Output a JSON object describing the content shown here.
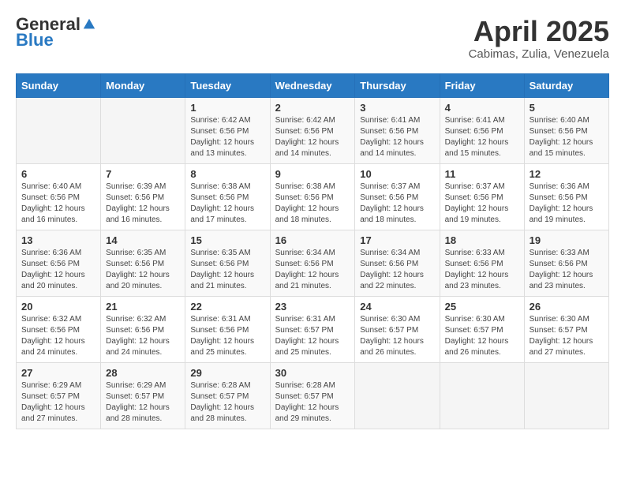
{
  "logo": {
    "general": "General",
    "blue": "Blue"
  },
  "header": {
    "month_title": "April 2025",
    "subtitle": "Cabimas, Zulia, Venezuela"
  },
  "weekdays": [
    "Sunday",
    "Monday",
    "Tuesday",
    "Wednesday",
    "Thursday",
    "Friday",
    "Saturday"
  ],
  "weeks": [
    [
      {
        "day": "",
        "sunrise": "",
        "sunset": "",
        "daylight": ""
      },
      {
        "day": "",
        "sunrise": "",
        "sunset": "",
        "daylight": ""
      },
      {
        "day": "1",
        "sunrise": "Sunrise: 6:42 AM",
        "sunset": "Sunset: 6:56 PM",
        "daylight": "Daylight: 12 hours and 13 minutes."
      },
      {
        "day": "2",
        "sunrise": "Sunrise: 6:42 AM",
        "sunset": "Sunset: 6:56 PM",
        "daylight": "Daylight: 12 hours and 14 minutes."
      },
      {
        "day": "3",
        "sunrise": "Sunrise: 6:41 AM",
        "sunset": "Sunset: 6:56 PM",
        "daylight": "Daylight: 12 hours and 14 minutes."
      },
      {
        "day": "4",
        "sunrise": "Sunrise: 6:41 AM",
        "sunset": "Sunset: 6:56 PM",
        "daylight": "Daylight: 12 hours and 15 minutes."
      },
      {
        "day": "5",
        "sunrise": "Sunrise: 6:40 AM",
        "sunset": "Sunset: 6:56 PM",
        "daylight": "Daylight: 12 hours and 15 minutes."
      }
    ],
    [
      {
        "day": "6",
        "sunrise": "Sunrise: 6:40 AM",
        "sunset": "Sunset: 6:56 PM",
        "daylight": "Daylight: 12 hours and 16 minutes."
      },
      {
        "day": "7",
        "sunrise": "Sunrise: 6:39 AM",
        "sunset": "Sunset: 6:56 PM",
        "daylight": "Daylight: 12 hours and 16 minutes."
      },
      {
        "day": "8",
        "sunrise": "Sunrise: 6:38 AM",
        "sunset": "Sunset: 6:56 PM",
        "daylight": "Daylight: 12 hours and 17 minutes."
      },
      {
        "day": "9",
        "sunrise": "Sunrise: 6:38 AM",
        "sunset": "Sunset: 6:56 PM",
        "daylight": "Daylight: 12 hours and 18 minutes."
      },
      {
        "day": "10",
        "sunrise": "Sunrise: 6:37 AM",
        "sunset": "Sunset: 6:56 PM",
        "daylight": "Daylight: 12 hours and 18 minutes."
      },
      {
        "day": "11",
        "sunrise": "Sunrise: 6:37 AM",
        "sunset": "Sunset: 6:56 PM",
        "daylight": "Daylight: 12 hours and 19 minutes."
      },
      {
        "day": "12",
        "sunrise": "Sunrise: 6:36 AM",
        "sunset": "Sunset: 6:56 PM",
        "daylight": "Daylight: 12 hours and 19 minutes."
      }
    ],
    [
      {
        "day": "13",
        "sunrise": "Sunrise: 6:36 AM",
        "sunset": "Sunset: 6:56 PM",
        "daylight": "Daylight: 12 hours and 20 minutes."
      },
      {
        "day": "14",
        "sunrise": "Sunrise: 6:35 AM",
        "sunset": "Sunset: 6:56 PM",
        "daylight": "Daylight: 12 hours and 20 minutes."
      },
      {
        "day": "15",
        "sunrise": "Sunrise: 6:35 AM",
        "sunset": "Sunset: 6:56 PM",
        "daylight": "Daylight: 12 hours and 21 minutes."
      },
      {
        "day": "16",
        "sunrise": "Sunrise: 6:34 AM",
        "sunset": "Sunset: 6:56 PM",
        "daylight": "Daylight: 12 hours and 21 minutes."
      },
      {
        "day": "17",
        "sunrise": "Sunrise: 6:34 AM",
        "sunset": "Sunset: 6:56 PM",
        "daylight": "Daylight: 12 hours and 22 minutes."
      },
      {
        "day": "18",
        "sunrise": "Sunrise: 6:33 AM",
        "sunset": "Sunset: 6:56 PM",
        "daylight": "Daylight: 12 hours and 23 minutes."
      },
      {
        "day": "19",
        "sunrise": "Sunrise: 6:33 AM",
        "sunset": "Sunset: 6:56 PM",
        "daylight": "Daylight: 12 hours and 23 minutes."
      }
    ],
    [
      {
        "day": "20",
        "sunrise": "Sunrise: 6:32 AM",
        "sunset": "Sunset: 6:56 PM",
        "daylight": "Daylight: 12 hours and 24 minutes."
      },
      {
        "day": "21",
        "sunrise": "Sunrise: 6:32 AM",
        "sunset": "Sunset: 6:56 PM",
        "daylight": "Daylight: 12 hours and 24 minutes."
      },
      {
        "day": "22",
        "sunrise": "Sunrise: 6:31 AM",
        "sunset": "Sunset: 6:56 PM",
        "daylight": "Daylight: 12 hours and 25 minutes."
      },
      {
        "day": "23",
        "sunrise": "Sunrise: 6:31 AM",
        "sunset": "Sunset: 6:57 PM",
        "daylight": "Daylight: 12 hours and 25 minutes."
      },
      {
        "day": "24",
        "sunrise": "Sunrise: 6:30 AM",
        "sunset": "Sunset: 6:57 PM",
        "daylight": "Daylight: 12 hours and 26 minutes."
      },
      {
        "day": "25",
        "sunrise": "Sunrise: 6:30 AM",
        "sunset": "Sunset: 6:57 PM",
        "daylight": "Daylight: 12 hours and 26 minutes."
      },
      {
        "day": "26",
        "sunrise": "Sunrise: 6:30 AM",
        "sunset": "Sunset: 6:57 PM",
        "daylight": "Daylight: 12 hours and 27 minutes."
      }
    ],
    [
      {
        "day": "27",
        "sunrise": "Sunrise: 6:29 AM",
        "sunset": "Sunset: 6:57 PM",
        "daylight": "Daylight: 12 hours and 27 minutes."
      },
      {
        "day": "28",
        "sunrise": "Sunrise: 6:29 AM",
        "sunset": "Sunset: 6:57 PM",
        "daylight": "Daylight: 12 hours and 28 minutes."
      },
      {
        "day": "29",
        "sunrise": "Sunrise: 6:28 AM",
        "sunset": "Sunset: 6:57 PM",
        "daylight": "Daylight: 12 hours and 28 minutes."
      },
      {
        "day": "30",
        "sunrise": "Sunrise: 6:28 AM",
        "sunset": "Sunset: 6:57 PM",
        "daylight": "Daylight: 12 hours and 29 minutes."
      },
      {
        "day": "",
        "sunrise": "",
        "sunset": "",
        "daylight": ""
      },
      {
        "day": "",
        "sunrise": "",
        "sunset": "",
        "daylight": ""
      },
      {
        "day": "",
        "sunrise": "",
        "sunset": "",
        "daylight": ""
      }
    ]
  ]
}
